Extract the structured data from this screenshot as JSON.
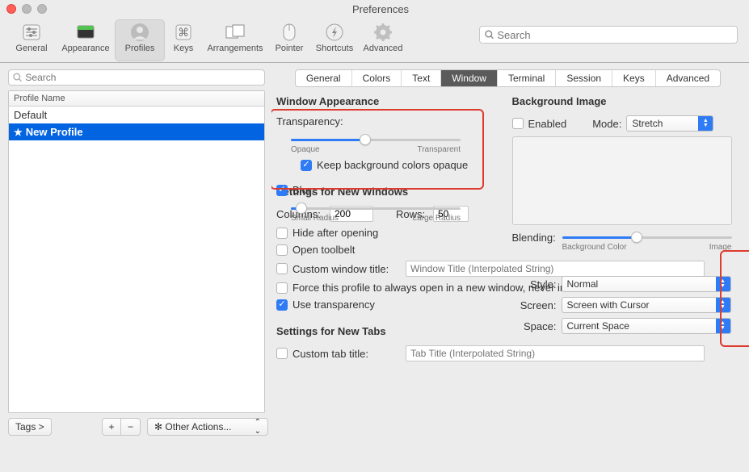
{
  "title": "Preferences",
  "searchPlaceholder": "Search",
  "toolbar": [
    {
      "name": "general",
      "label": "General"
    },
    {
      "name": "appearance",
      "label": "Appearance"
    },
    {
      "name": "profiles",
      "label": "Profiles"
    },
    {
      "name": "keys",
      "label": "Keys"
    },
    {
      "name": "arrangements",
      "label": "Arrangements"
    },
    {
      "name": "pointer",
      "label": "Pointer"
    },
    {
      "name": "shortcuts",
      "label": "Shortcuts"
    },
    {
      "name": "advanced",
      "label": "Advanced"
    }
  ],
  "left": {
    "searchPlaceholder": "Search",
    "header": "Profile Name",
    "rows": [
      {
        "label": "Default",
        "selected": false,
        "starred": false
      },
      {
        "label": "New Profile",
        "selected": true,
        "starred": true
      }
    ],
    "tagsBtn": "Tags >",
    "otherActions": "Other Actions..."
  },
  "tabs": [
    "General",
    "Colors",
    "Text",
    "Window",
    "Terminal",
    "Session",
    "Keys",
    "Advanced"
  ],
  "tabSelected": "Window",
  "appearance": {
    "heading": "Window Appearance",
    "transparencyLabel": "Transparency:",
    "transLow": "Opaque",
    "transHigh": "Transparent",
    "keepOpaque": "Keep background colors opaque",
    "blurLabel": "Blur:",
    "blurLow": "Small Radius",
    "blurHigh": "Large Radius"
  },
  "bg": {
    "heading": "Background Image",
    "enabled": "Enabled",
    "modeLabel": "Mode:",
    "modeValue": "Stretch",
    "blendingLabel": "Blending:",
    "blendLow": "Background Color",
    "blendHigh": "Image"
  },
  "newwin": {
    "heading": "Settings for New Windows",
    "columnsLabel": "Columns:",
    "columnsVal": "200",
    "rowsLabel": "Rows:",
    "rowsVal": "50",
    "hide": "Hide after opening",
    "toolbelt": "Open toolbelt",
    "customTitle": "Custom window title:",
    "customTitlePH": "Window Title (Interpolated String)",
    "forceNew": "Force this profile to always open in a new window, never in a tab.",
    "useTrans": "Use transparency",
    "styleLabel": "Style:",
    "styleVal": "Normal",
    "screenLabel": "Screen:",
    "screenVal": "Screen with Cursor",
    "spaceLabel": "Space:",
    "spaceVal": "Current Space"
  },
  "newtabs": {
    "heading": "Settings for New Tabs",
    "customTitle": "Custom tab title:",
    "customTitlePH": "Tab Title (Interpolated String)"
  }
}
